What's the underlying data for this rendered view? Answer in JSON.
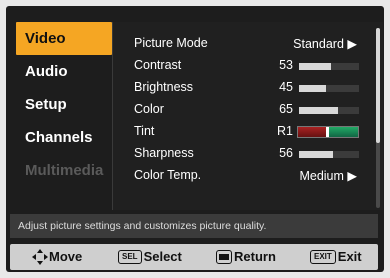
{
  "sidebar": {
    "items": [
      {
        "label": "Video",
        "state": "active"
      },
      {
        "label": "Audio",
        "state": "normal"
      },
      {
        "label": "Setup",
        "state": "normal"
      },
      {
        "label": "Channels",
        "state": "normal"
      },
      {
        "label": "Multimedia",
        "state": "disabled"
      }
    ]
  },
  "settings": {
    "picture_mode": {
      "label": "Picture Mode",
      "value": "Standard ▶"
    },
    "contrast": {
      "label": "Contrast",
      "value": "53",
      "level": 53
    },
    "brightness": {
      "label": "Brightness",
      "value": "45",
      "level": 45
    },
    "color": {
      "label": "Color",
      "value": "65",
      "level": 65
    },
    "tint": {
      "label": "Tint",
      "value": "R1",
      "level": 49
    },
    "sharpness": {
      "label": "Sharpness",
      "value": "56",
      "level": 56
    },
    "color_temp": {
      "label": "Color Temp.",
      "value": "Medium ▶"
    }
  },
  "scroll_fraction": 0.64,
  "help_text": "Adjust picture settings and customizes picture quality.",
  "footer": {
    "move": "Move",
    "select_key": "SEL",
    "select": "Select",
    "return": "Return",
    "exit_key": "EXIT",
    "exit": "Exit"
  },
  "colors": {
    "accent": "#f5a623",
    "bar_fill": "#d8d8d8",
    "tint_red": "#a22",
    "tint_green": "#2a6"
  }
}
